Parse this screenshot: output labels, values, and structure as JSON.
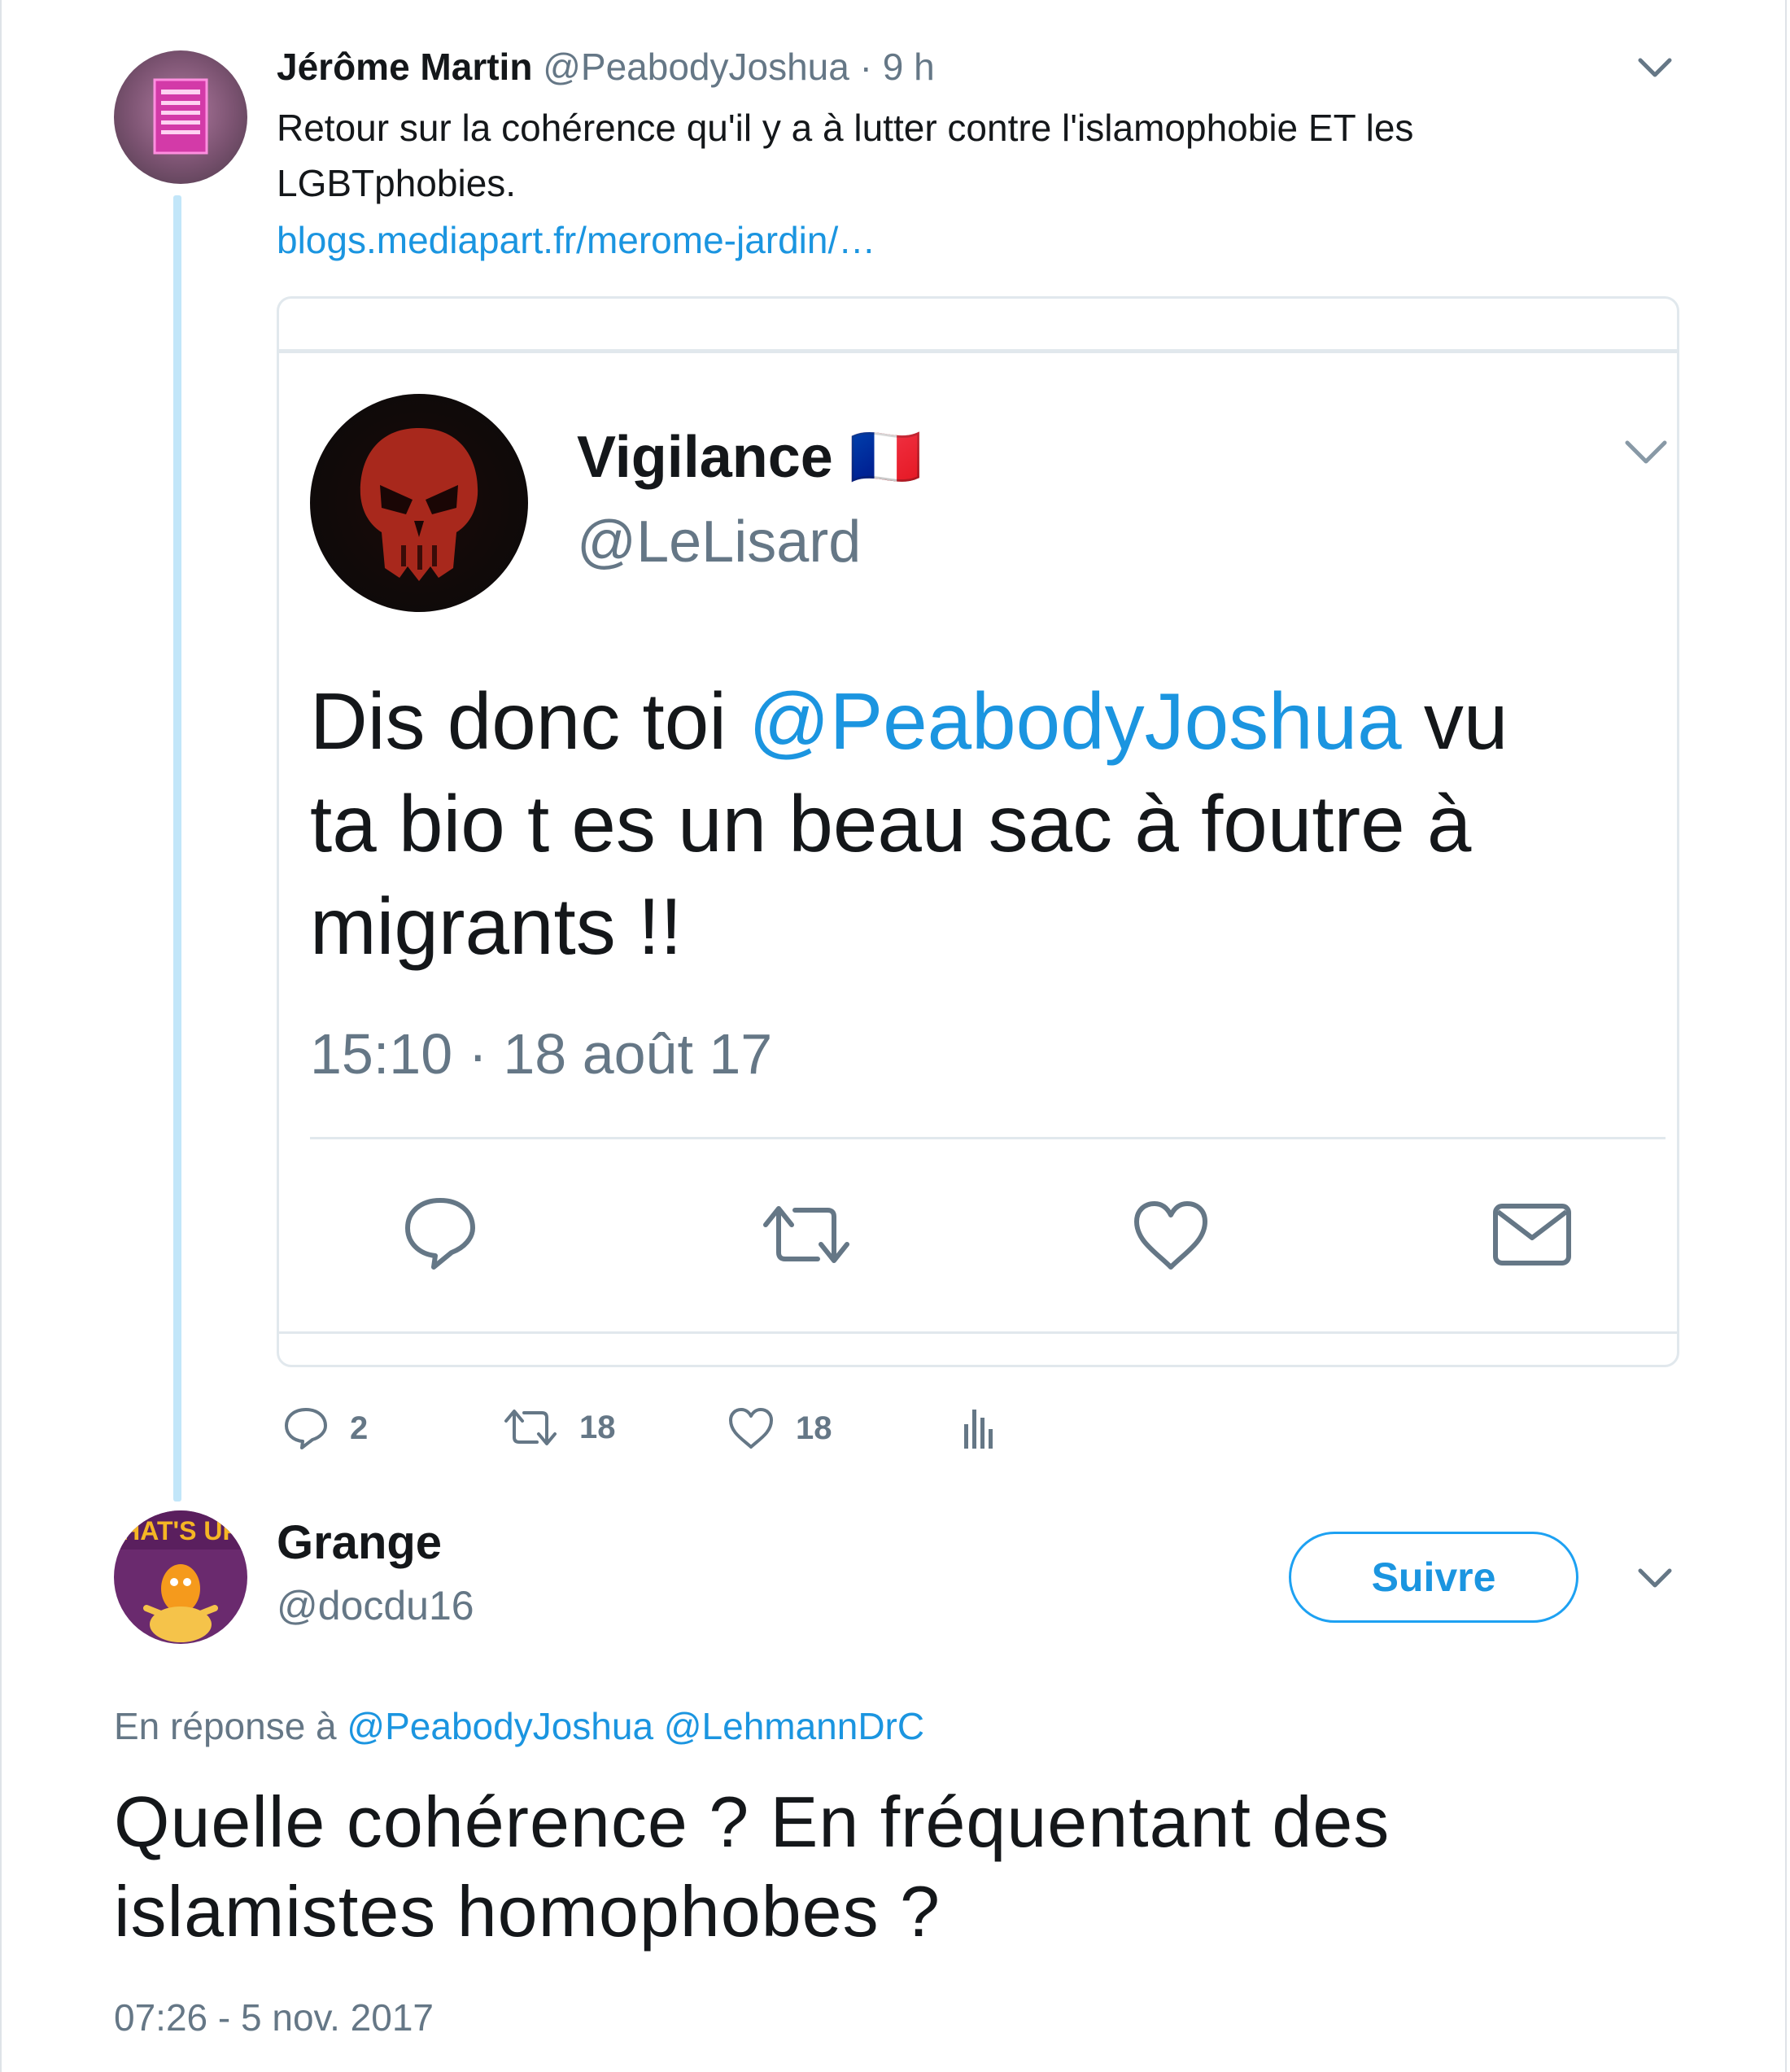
{
  "original_tweet": {
    "author_name": "Jérôme Martin",
    "author_handle": "@PeabodyJoshua",
    "time_ago": "· 9 h",
    "text_line1": "Retour sur la cohérence qu'il y a à lutter contre l'islamophobie ET les",
    "text_line2": "LGBTphobies.",
    "link": "blogs.mediapart.fr/merome-jardin/…",
    "avatar_sign_text": "PMA LGBT ET AID",
    "actions": {
      "reply_count": "2",
      "retweet_count": "18",
      "like_count": "18"
    }
  },
  "embedded_tweet": {
    "author_name": "Vigilance",
    "flag": "🇫🇷",
    "author_handle": "@LeLisard",
    "text_part1": "Dis donc toi ",
    "mention": "@PeabodyJoshua",
    "text_part2": " vu",
    "text_line2": "ta bio t es un beau sac à foutre à",
    "text_line3": "migrants !!",
    "timestamp": "15:10 · 18 août 17"
  },
  "reply_tweet": {
    "author_name": "Grange",
    "author_handle": "@docdu16",
    "follow_label": "Suivre",
    "avatar_text": "HAT'S UP",
    "in_reply_prefix": "En réponse à ",
    "reply_mentions": [
      "@PeabodyJoshua",
      "@LehmannDrC"
    ],
    "text_line1": "Quelle cohérence ? En fréquentant des",
    "text_line2": "islamistes homophobes ?",
    "timestamp": "07:26 - 5 nov. 2017"
  },
  "colors": {
    "link_blue": "#1b95e0",
    "muted": "#657786",
    "thread_line": "#c2e6f9"
  }
}
